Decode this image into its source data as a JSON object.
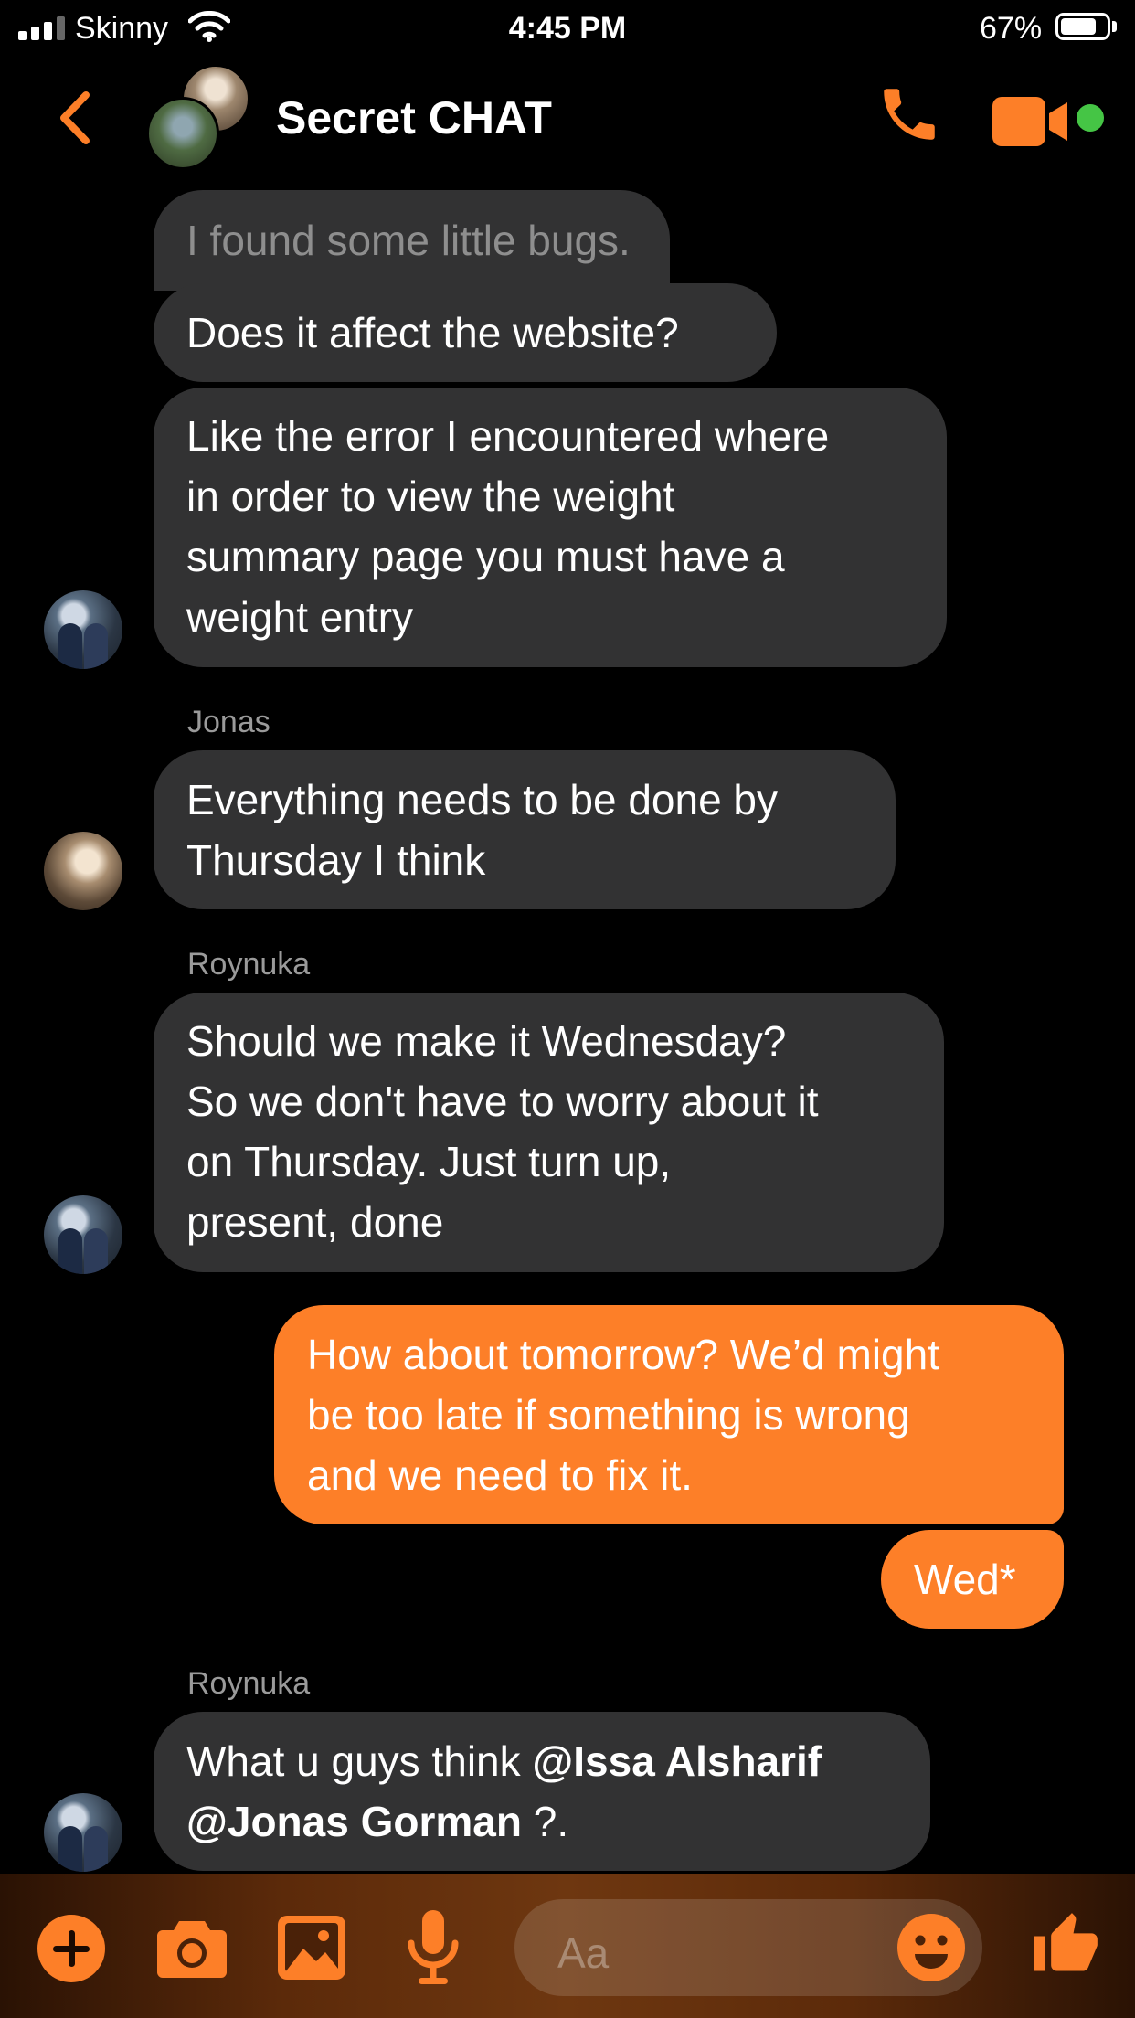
{
  "status_bar": {
    "carrier": "Skinny",
    "time": "4:45 PM",
    "battery": "67%",
    "battery_level": 0.67
  },
  "header": {
    "title": "Secret CHAT",
    "icons": [
      "chevron-left-icon",
      "group-avatar",
      "phone-icon",
      "video-camera-icon",
      "online-dot"
    ]
  },
  "colors": {
    "accent": "#fd7f28",
    "incoming_bubble": "#323233",
    "background": "#000000",
    "sender_name": "#9a9a9a",
    "online": "#45c545"
  },
  "messages": [
    {
      "text": "I found some little bugs."
    },
    {
      "text": "Does it affect the website?"
    },
    {
      "lines": [
        "Like the error I encountered where",
        "in order to view the weight",
        "summary page you must have a",
        "weight entry"
      ]
    },
    {
      "sender": "Jonas",
      "lines": [
        "Everything needs to be done by",
        "Thursday I think"
      ]
    },
    {
      "sender": "Roynuka",
      "lines": [
        "Should we make it Wednesday?",
        "So we don't have to worry about it",
        "on Thursday. Just turn up,",
        "present, done"
      ]
    },
    {
      "lines": [
        "How about tomorrow? We’d might",
        "be too late if something is wrong",
        "and we need to fix it."
      ]
    },
    {
      "text": "Wed*"
    },
    {
      "sender": "Roynuka",
      "parts": [
        "What u guys think ",
        "@Issa Alsharif",
        "@Jonas Gorman",
        " ?."
      ]
    }
  ],
  "composer": {
    "placeholder": "Aa",
    "icons": [
      "plus-icon",
      "camera-icon",
      "image-icon",
      "microphone-icon",
      "emoji-icon",
      "thumbs-up-icon"
    ]
  }
}
